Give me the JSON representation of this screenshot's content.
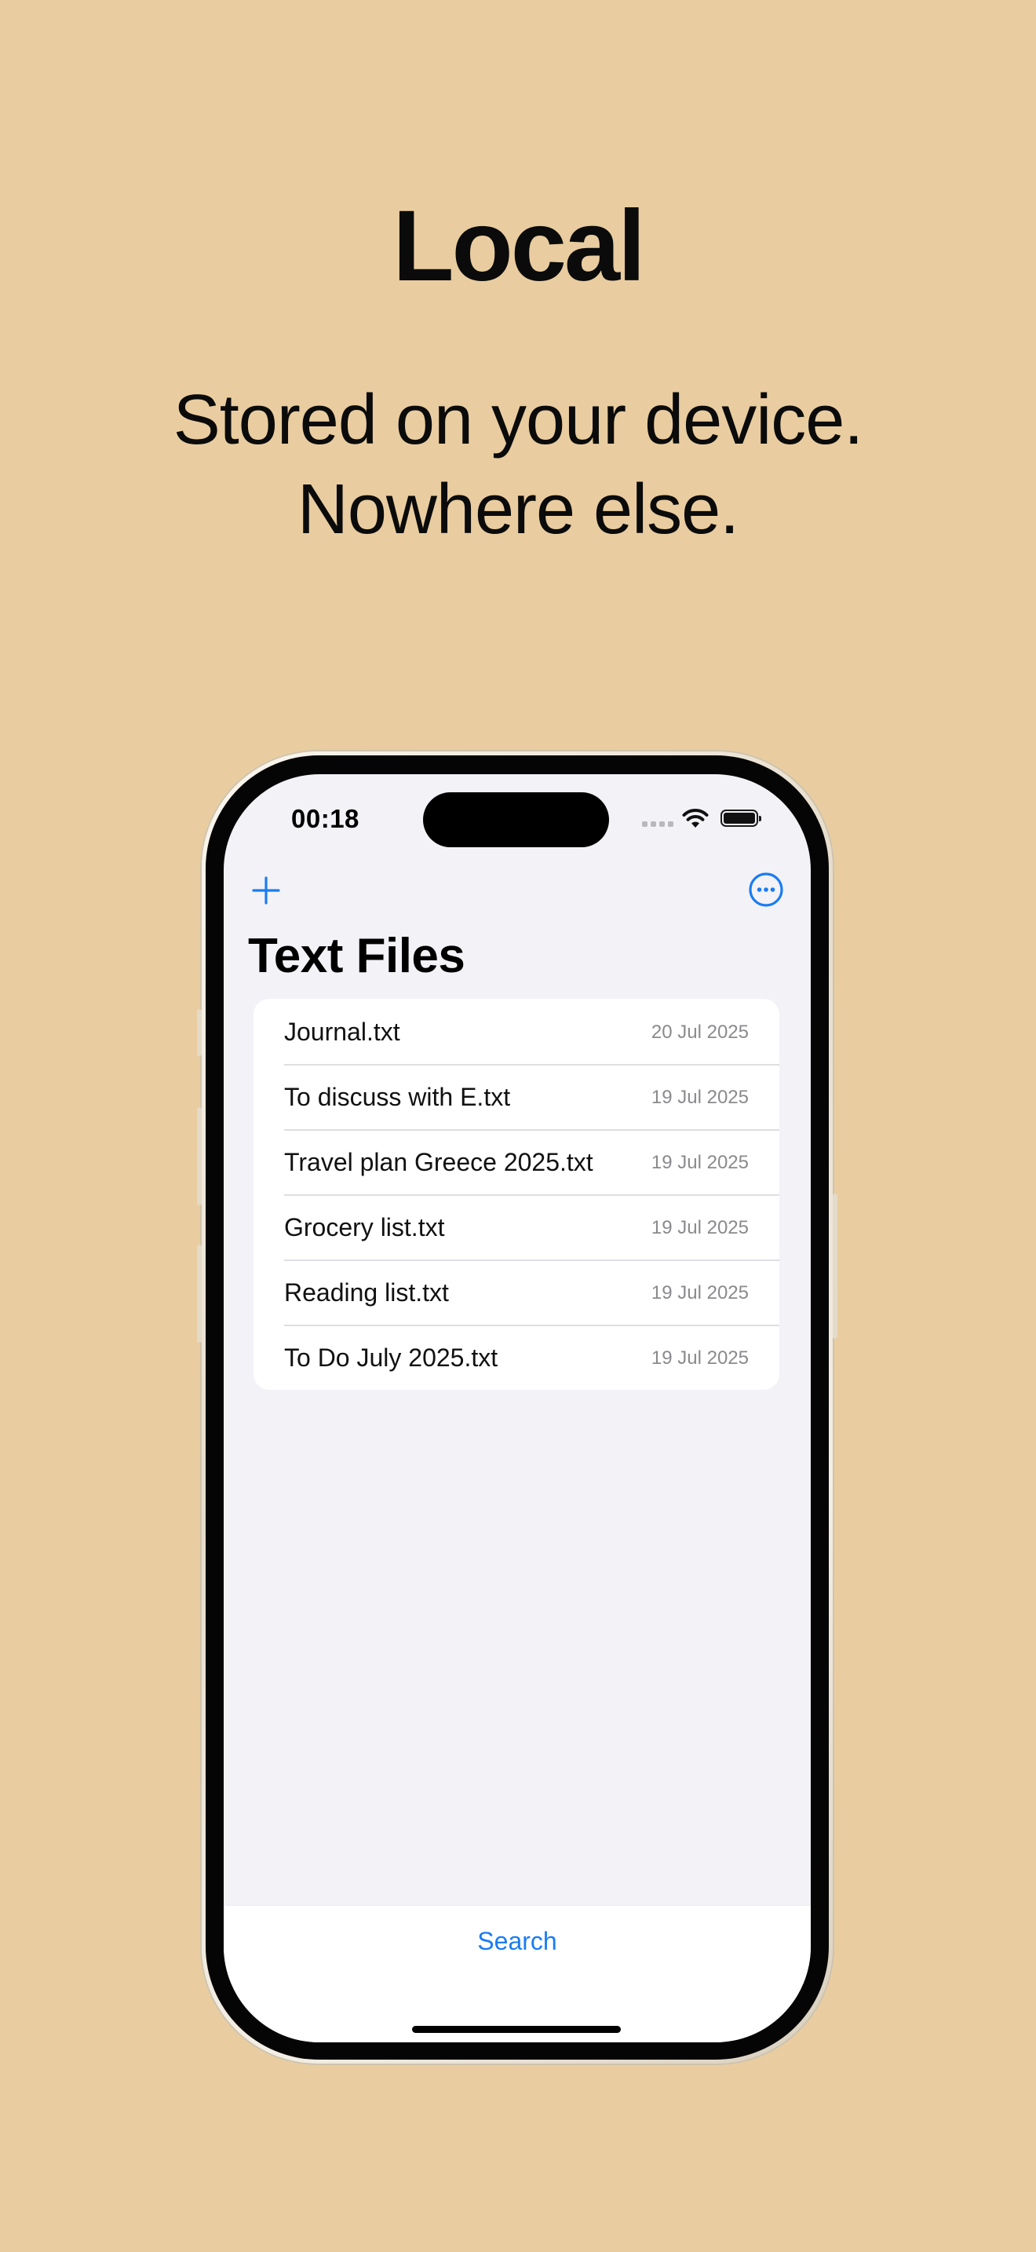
{
  "promo": {
    "headline": "Local",
    "subhead_line1": "Stored on your device.",
    "subhead_line2": "Nowhere else."
  },
  "status_bar": {
    "time": "00:18"
  },
  "nav": {
    "add_icon": "plus-icon",
    "more_icon": "ellipsis-circle-icon"
  },
  "screen": {
    "title": "Text Files"
  },
  "files": [
    {
      "name": "Journal.txt",
      "date": "20 Jul 2025"
    },
    {
      "name": "To discuss with E.txt",
      "date": "19 Jul 2025"
    },
    {
      "name": "Travel plan Greece 2025.txt",
      "date": "19 Jul 2025"
    },
    {
      "name": "Grocery list.txt",
      "date": "19 Jul 2025"
    },
    {
      "name": "Reading list.txt",
      "date": "19 Jul 2025"
    },
    {
      "name": "To Do July 2025.txt",
      "date": "19 Jul 2025"
    }
  ],
  "tabbar": {
    "search_label": "Search"
  },
  "colors": {
    "background": "#E9CDA0",
    "accent": "#1A7CF2",
    "screen_bg": "#F2F2F7"
  }
}
